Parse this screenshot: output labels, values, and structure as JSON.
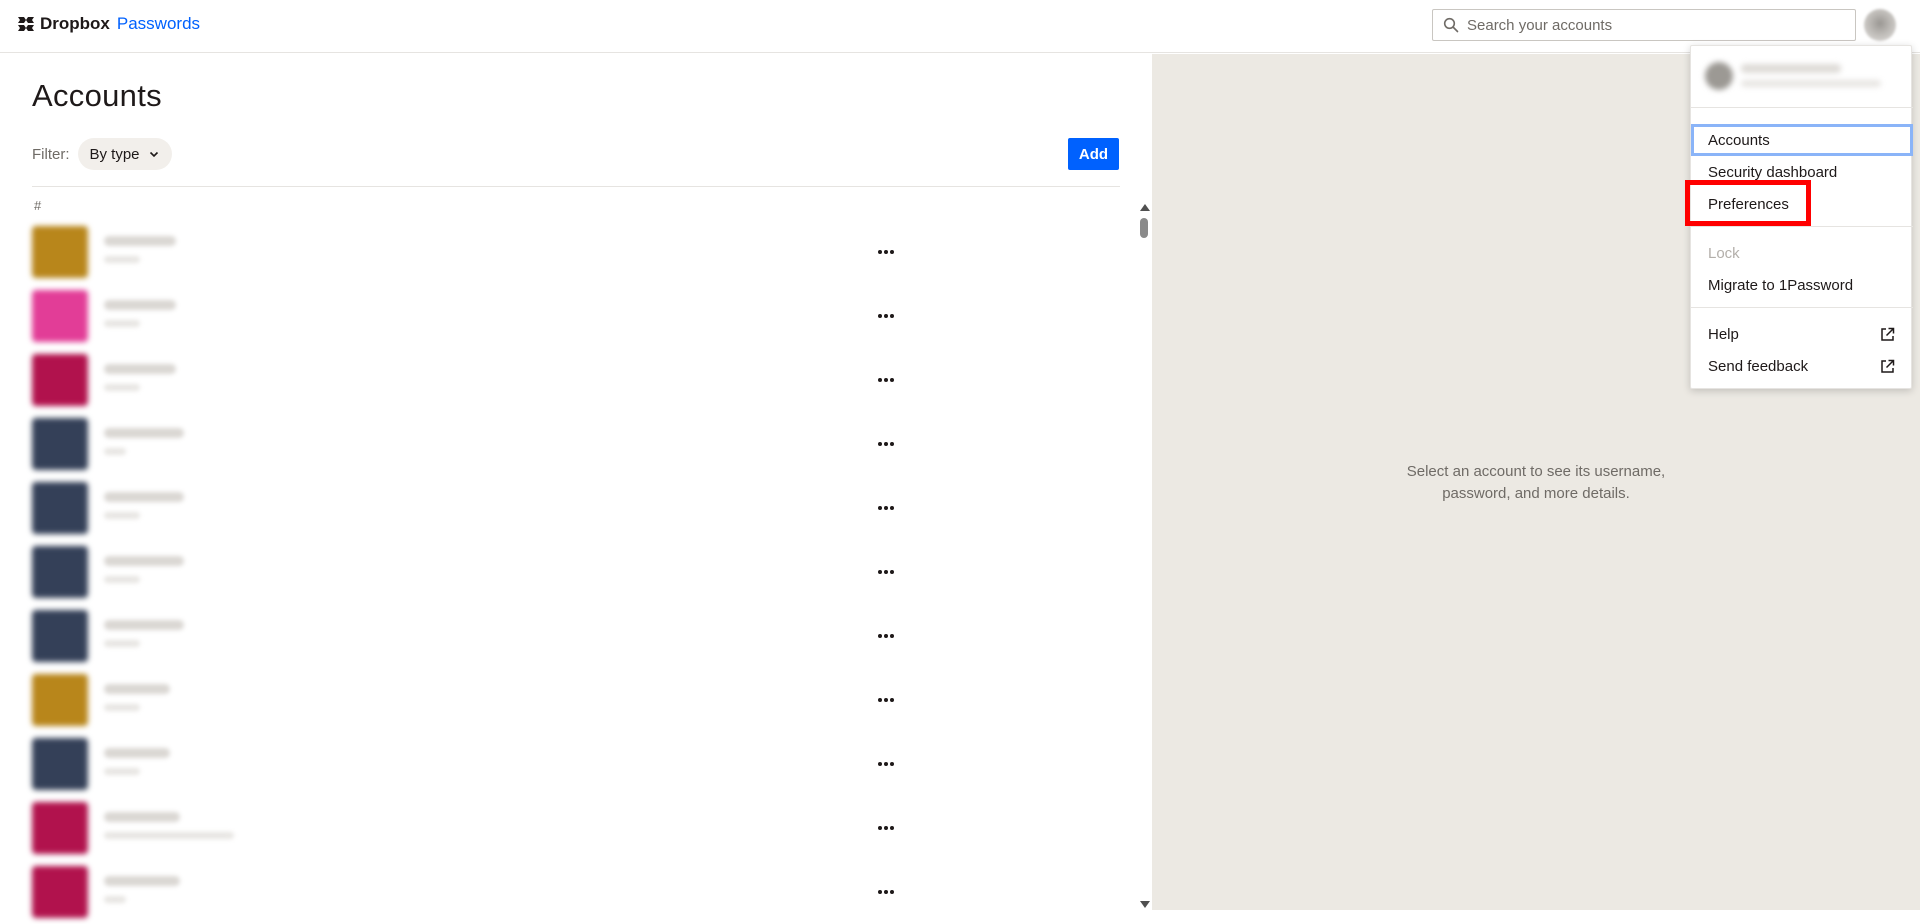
{
  "header": {
    "brand_dropbox": "Dropbox",
    "brand_passwords": "Passwords",
    "search_placeholder": "Search your accounts"
  },
  "accounts_page": {
    "title": "Accounts",
    "filter_label": "Filter:",
    "filter_value": "By type",
    "add_label": "Add",
    "group_header": "#"
  },
  "accounts": [
    {
      "color": "#b8861b"
    },
    {
      "color": "#e23d97"
    },
    {
      "color": "#b1124d"
    },
    {
      "color": "#344058"
    },
    {
      "color": "#344058"
    },
    {
      "color": "#344058"
    },
    {
      "color": "#344058"
    },
    {
      "color": "#b8861b"
    },
    {
      "color": "#344058"
    },
    {
      "color": "#b1124d"
    },
    {
      "color": "#b1124d"
    }
  ],
  "detail_panel": {
    "empty_line1": "Select an account to see its username,",
    "empty_line2": "password, and more details."
  },
  "menu": {
    "accounts": "Accounts",
    "security_dashboard": "Security dashboard",
    "preferences": "Preferences",
    "lock": "Lock",
    "migrate": "Migrate to 1Password",
    "help": "Help",
    "send_feedback": "Send feedback"
  },
  "colors": {
    "accent": "#0061fe",
    "highlight": "#ff0000",
    "detail_background": "#ece9e3"
  }
}
